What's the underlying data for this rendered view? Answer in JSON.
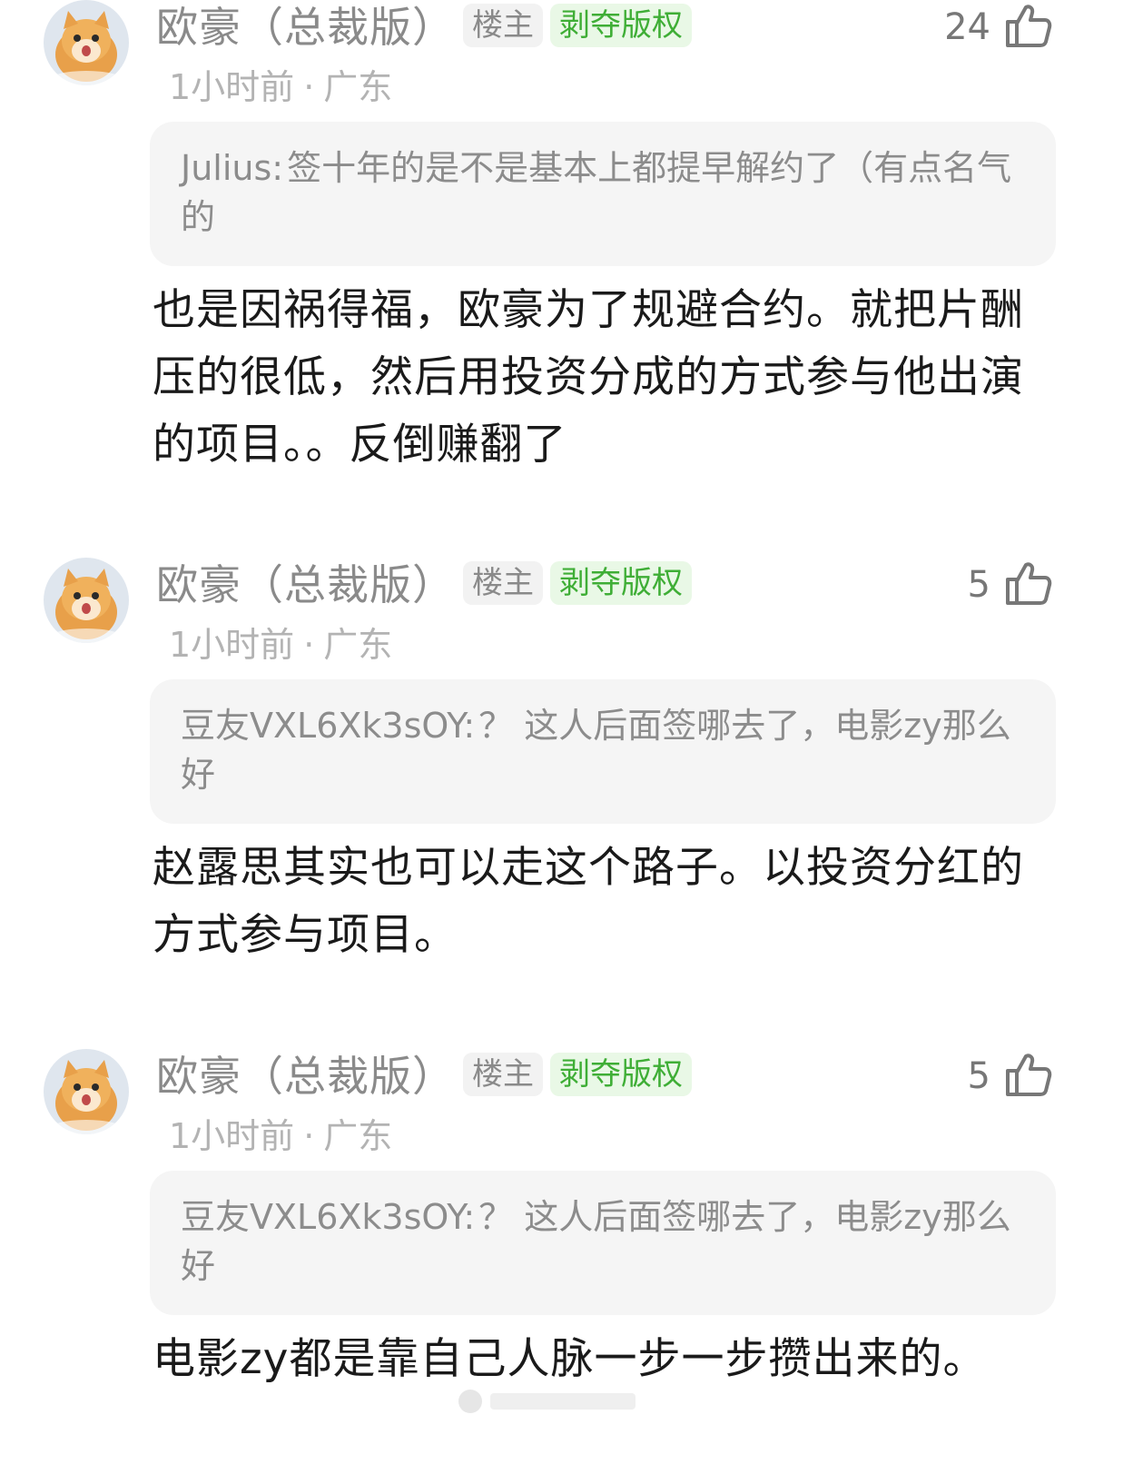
{
  "colors": {
    "name_gray": "#8a8a8a",
    "meta_gray": "#b3b3b3",
    "quote_bg": "#f5f5f5",
    "host_badge_bg": "#f2f2f2",
    "title_badge_bg": "#e9f8e6",
    "title_badge_text": "#3fae36"
  },
  "comments": [
    {
      "author": "欧豪（总裁版）",
      "host_badge": "楼主",
      "title_badge": "剥夺版权",
      "likes": "24",
      "time": "1小时前",
      "separator": "·",
      "location": "广东",
      "quote_author": "Julius:",
      "quote_text": "签十年的是不是基本上都提早解约了（有点名气的",
      "text": "也是因祸得福，欧豪为了规避合约。就把片酬压的很低，然后用投资分成的方式参与他出演的项目。。反倒赚翻了",
      "like_icon": "thumbs-up-icon",
      "avatar_icon": "orange-cat-avatar"
    },
    {
      "author": "欧豪（总裁版）",
      "host_badge": "楼主",
      "title_badge": "剥夺版权",
      "likes": "5",
      "time": "1小时前",
      "separator": "·",
      "location": "广东",
      "quote_author": "豆友VXL6Xk3sOY:",
      "quote_text": "？ 这人后面签哪去了，电影zy那么好",
      "text": "赵露思其实也可以走这个路子。以投资分红的方式参与项目。",
      "like_icon": "thumbs-up-icon",
      "avatar_icon": "orange-cat-avatar"
    },
    {
      "author": "欧豪（总裁版）",
      "host_badge": "楼主",
      "title_badge": "剥夺版权",
      "likes": "5",
      "time": "1小时前",
      "separator": "·",
      "location": "广东",
      "quote_author": "豆友VXL6Xk3sOY:",
      "quote_text": "？ 这人后面签哪去了，电影zy那么好",
      "text": "电影zy都是靠自己人脉一步一步攒出来的。",
      "like_icon": "thumbs-up-icon",
      "avatar_icon": "orange-cat-avatar"
    }
  ]
}
